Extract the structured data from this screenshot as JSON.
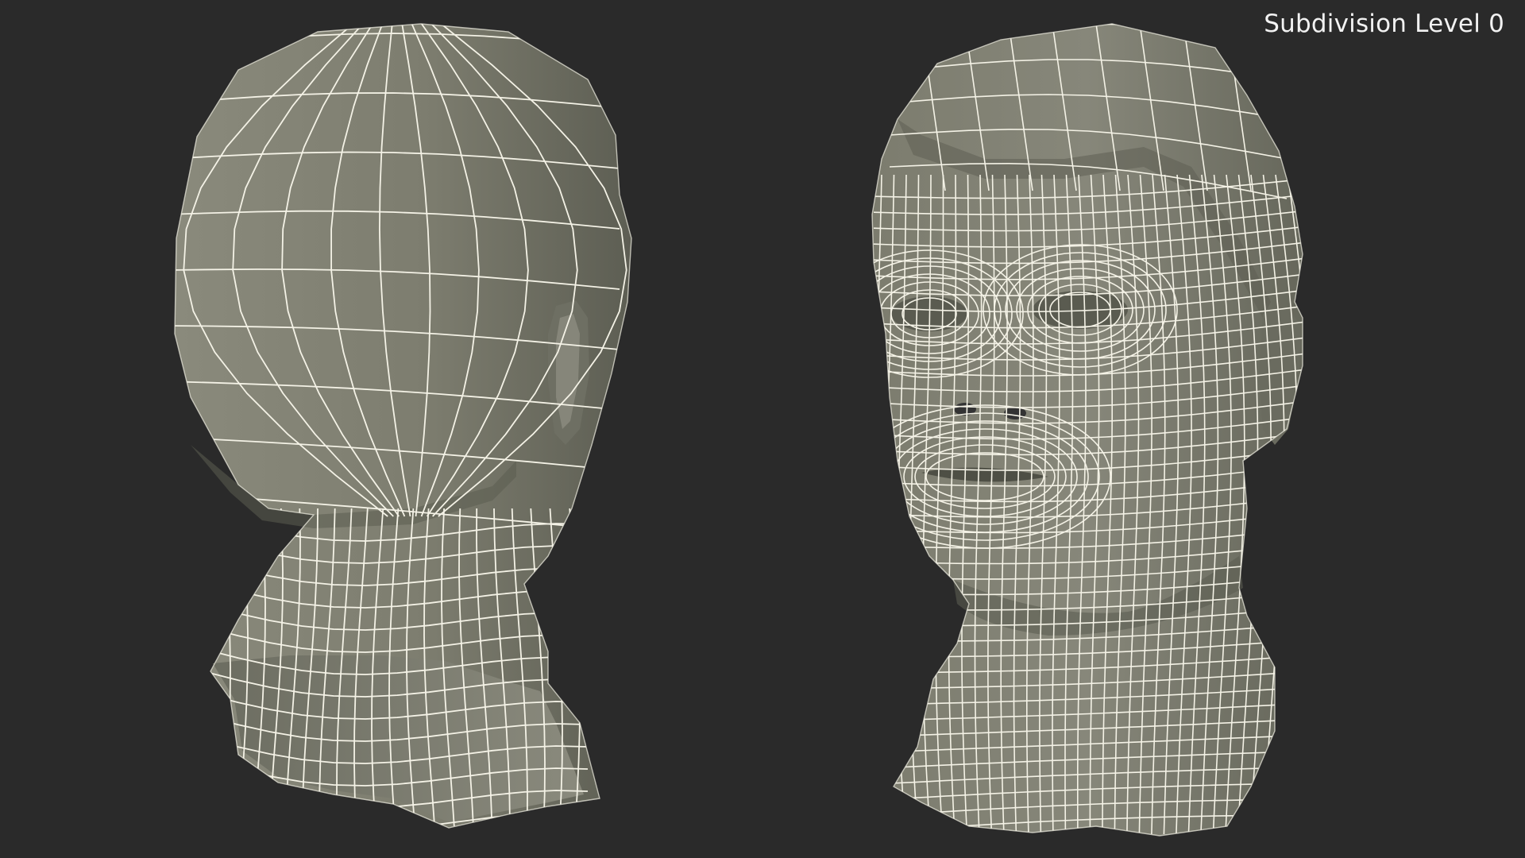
{
  "viewport": {
    "subdivision_label": "Subdivision Level 0"
  },
  "render": {
    "background": "#2a2a2a",
    "mesh_fill": "#7a7a6c",
    "mesh_shadow": "#55564b",
    "wire_color": "#f4f2e6"
  },
  "models": [
    {
      "name": "head-back-view",
      "view": "back three-quarter"
    },
    {
      "name": "head-front-view",
      "view": "front three-quarter"
    }
  ]
}
